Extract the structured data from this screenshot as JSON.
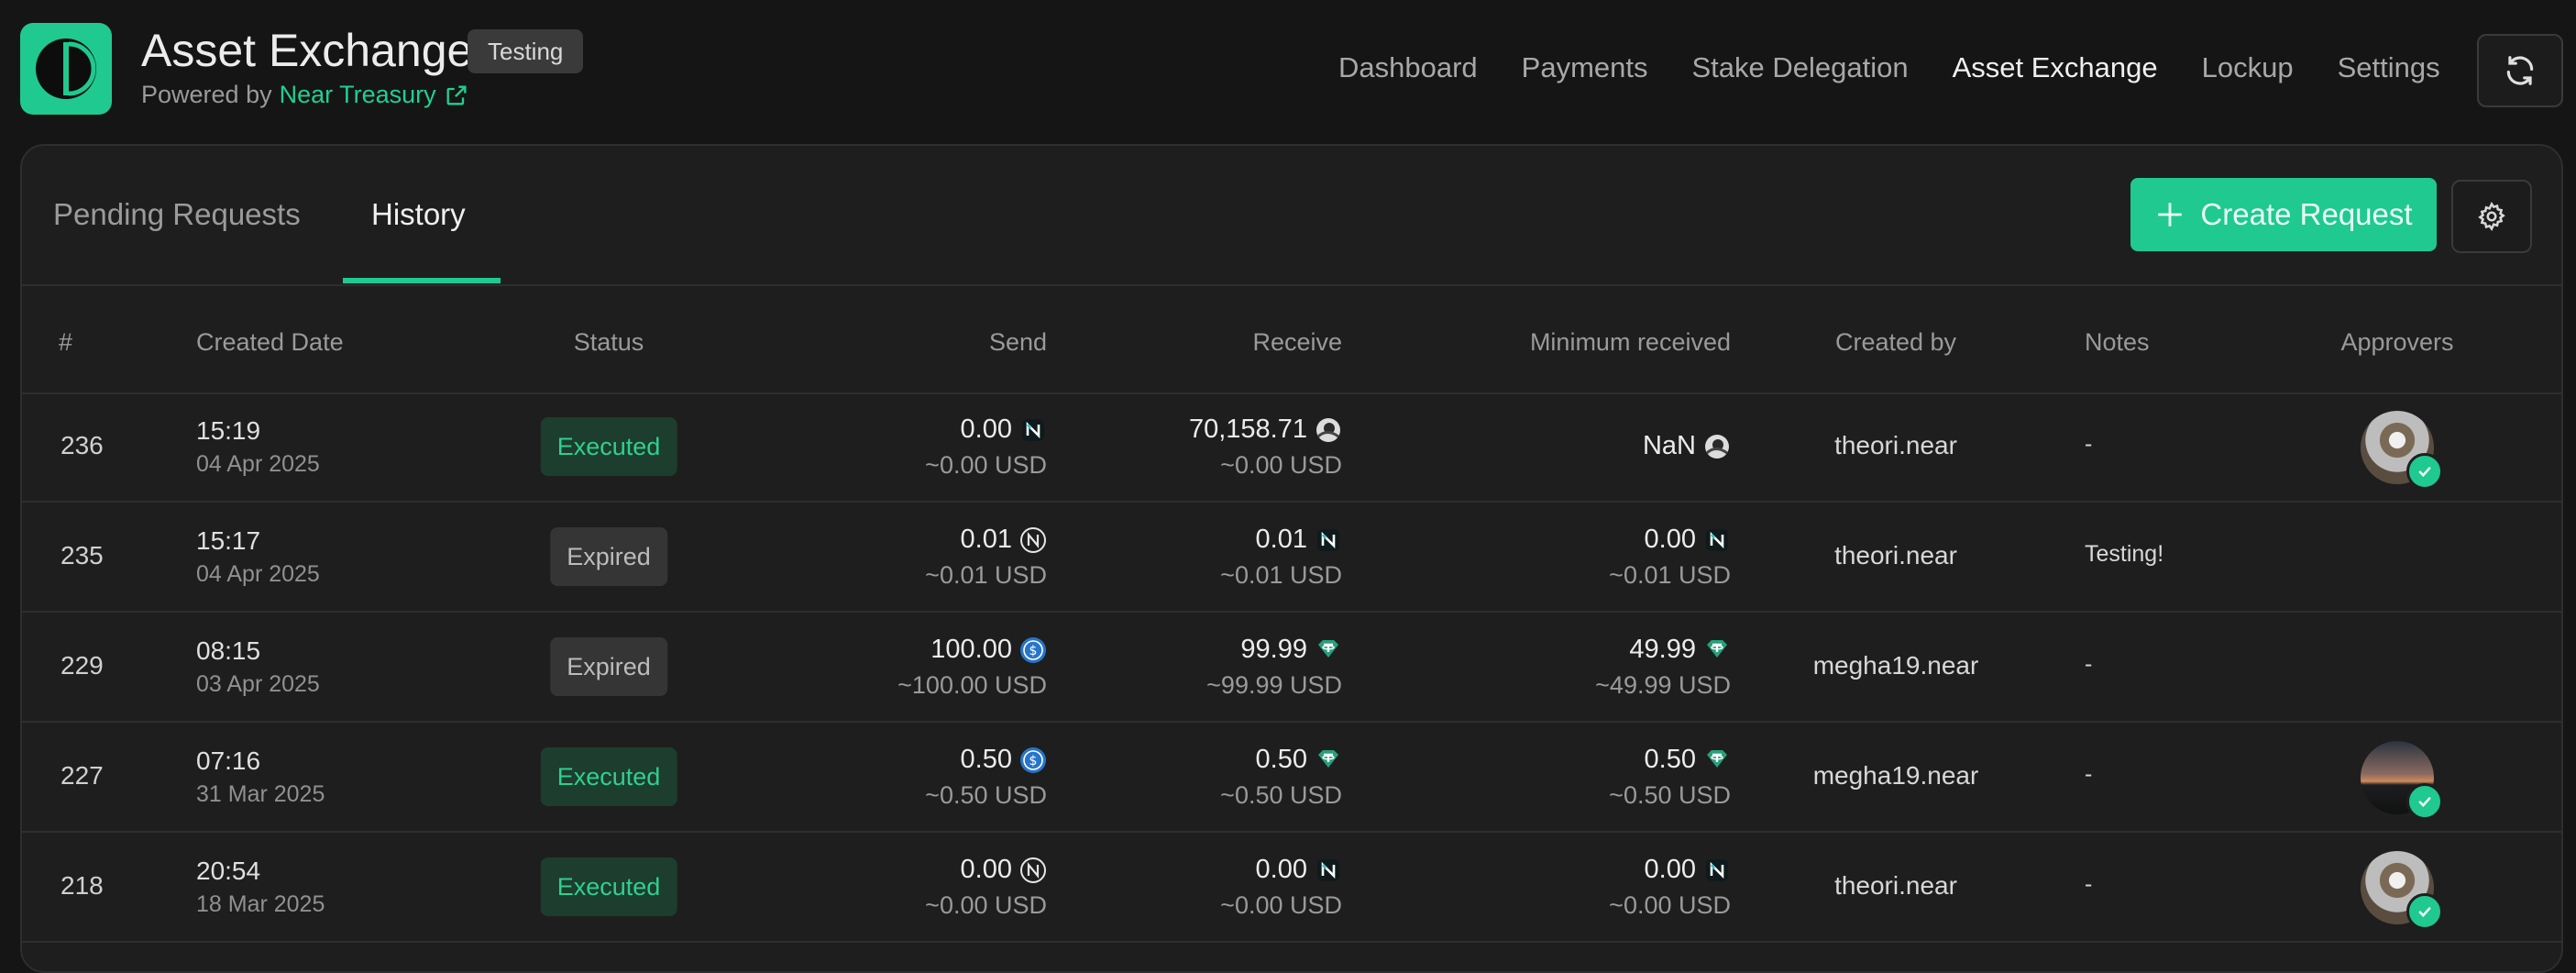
{
  "header": {
    "app_title": "Asset Exchange",
    "env_badge": "Testing",
    "powered_by_prefix": "Powered by",
    "powered_by_link": "Near Treasury",
    "nav": [
      {
        "label": "Dashboard",
        "active": false
      },
      {
        "label": "Payments",
        "active": false
      },
      {
        "label": "Stake Delegation",
        "active": false
      },
      {
        "label": "Asset Exchange",
        "active": true
      },
      {
        "label": "Lockup",
        "active": false
      },
      {
        "label": "Settings",
        "active": false
      }
    ]
  },
  "tabs": [
    {
      "label": "Pending Requests",
      "active": false
    },
    {
      "label": "History",
      "active": true
    }
  ],
  "create_button": "Create Request",
  "columns": [
    "#",
    "Created Date",
    "Status",
    "Send",
    "Receive",
    "Minimum received",
    "Created by",
    "Notes",
    "Approvers"
  ],
  "rows": [
    {
      "id": "236",
      "time": "15:19",
      "date": "04 Apr 2025",
      "status": "Executed",
      "send": {
        "amount": "0.00",
        "usd": "~0.00 USD",
        "icon": "near-wrapped-icon"
      },
      "receive": {
        "amount": "70,158.71",
        "usd": "~0.00 USD",
        "icon": "astronaut-token-icon"
      },
      "min": {
        "amount": "NaN",
        "usd": "",
        "icon": "astronaut-token-icon"
      },
      "created_by": "theori.near",
      "notes": "-",
      "approver": "avatar-person"
    },
    {
      "id": "235",
      "time": "15:17",
      "date": "04 Apr 2025",
      "status": "Expired",
      "send": {
        "amount": "0.01",
        "usd": "~0.01 USD",
        "icon": "near-icon"
      },
      "receive": {
        "amount": "0.01",
        "usd": "~0.01 USD",
        "icon": "near-wrapped-icon"
      },
      "min": {
        "amount": "0.00",
        "usd": "~0.01 USD",
        "icon": "near-wrapped-icon"
      },
      "created_by": "theori.near",
      "notes": "Testing!",
      "approver": ""
    },
    {
      "id": "229",
      "time": "08:15",
      "date": "03 Apr 2025",
      "status": "Expired",
      "send": {
        "amount": "100.00",
        "usd": "~100.00 USD",
        "icon": "usdc-icon"
      },
      "receive": {
        "amount": "99.99",
        "usd": "~99.99 USD",
        "icon": "usdt-icon"
      },
      "min": {
        "amount": "49.99",
        "usd": "~49.99 USD",
        "icon": "usdt-icon"
      },
      "created_by": "megha19.near",
      "notes": "-",
      "approver": ""
    },
    {
      "id": "227",
      "time": "07:16",
      "date": "31 Mar 2025",
      "status": "Executed",
      "send": {
        "amount": "0.50",
        "usd": "~0.50 USD",
        "icon": "usdc-icon"
      },
      "receive": {
        "amount": "0.50",
        "usd": "~0.50 USD",
        "icon": "usdt-icon"
      },
      "min": {
        "amount": "0.50",
        "usd": "~0.50 USD",
        "icon": "usdt-icon"
      },
      "created_by": "megha19.near",
      "notes": "-",
      "approver": "avatar-landscape"
    },
    {
      "id": "218",
      "time": "20:54",
      "date": "18 Mar 2025",
      "status": "Executed",
      "send": {
        "amount": "0.00",
        "usd": "~0.00 USD",
        "icon": "near-icon"
      },
      "receive": {
        "amount": "0.00",
        "usd": "~0.00 USD",
        "icon": "near-wrapped-icon"
      },
      "min": {
        "amount": "0.00",
        "usd": "~0.00 USD",
        "icon": "near-wrapped-icon"
      },
      "created_by": "theori.near",
      "notes": "-",
      "approver": "avatar-person"
    }
  ],
  "colors": {
    "accent": "#1fc98f",
    "background": "#151515",
    "card": "#1e1e1e"
  }
}
